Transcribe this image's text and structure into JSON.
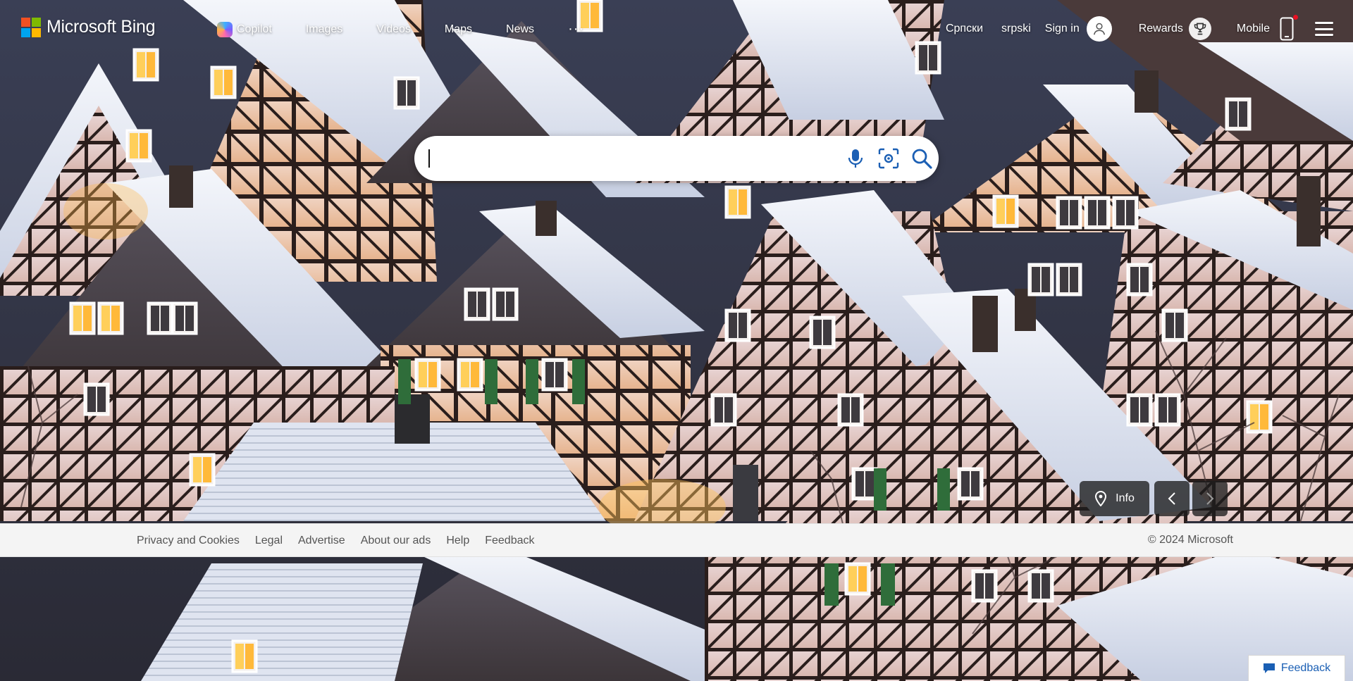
{
  "brand": {
    "name": "Microsoft Bing",
    "logo_colors": [
      "#f25022",
      "#7fba00",
      "#00a4ef",
      "#ffb900"
    ]
  },
  "nav": {
    "items": [
      "Copilot",
      "Images",
      "Videos",
      "Maps",
      "News"
    ],
    "more": "···"
  },
  "header_right": {
    "lang_cyrillic": "Српски",
    "lang_latin": "srpski",
    "sign_in": "Sign in",
    "rewards": "Rewards",
    "mobile": "Mobile"
  },
  "search": {
    "value": "",
    "placeholder": ""
  },
  "image_controls": {
    "info_label": "Info"
  },
  "footer": {
    "links": [
      "Privacy and Cookies",
      "Legal",
      "Advertise",
      "About our ads",
      "Help",
      "Feedback"
    ],
    "copyright": "© 2024 Microsoft"
  },
  "feedback_button": {
    "label": "Feedback"
  },
  "colors": {
    "accent": "#1a5fb4",
    "search_icon": "#1b5fb4",
    "footer_bg": "#f4f4f4"
  }
}
